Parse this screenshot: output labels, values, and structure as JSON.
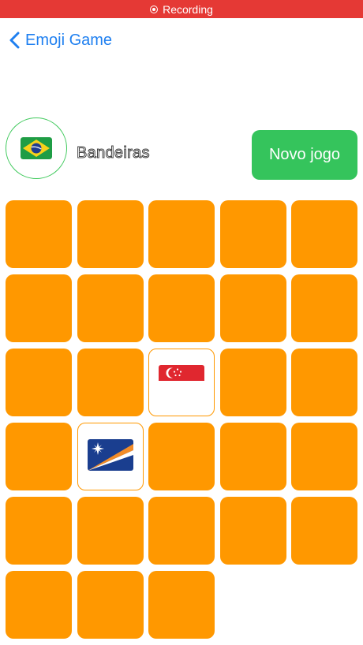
{
  "status_bar": {
    "label": "Recording"
  },
  "nav": {
    "back_label": "Emoji Game"
  },
  "header": {
    "category_icon": "brazil-flag",
    "category_label": "Bandeiras",
    "new_game_label": "Novo jogo"
  },
  "colors": {
    "card_back": "#ff9800",
    "new_game_button": "#35c45c",
    "recording_bar": "#e53935",
    "back_link": "#1e7ff0"
  },
  "cards": [
    {
      "state": "hidden"
    },
    {
      "state": "hidden"
    },
    {
      "state": "hidden"
    },
    {
      "state": "hidden"
    },
    {
      "state": "hidden"
    },
    {
      "state": "hidden"
    },
    {
      "state": "hidden"
    },
    {
      "state": "hidden"
    },
    {
      "state": "hidden"
    },
    {
      "state": "hidden"
    },
    {
      "state": "hidden"
    },
    {
      "state": "hidden"
    },
    {
      "state": "revealed",
      "flag": "singapore-flag"
    },
    {
      "state": "hidden"
    },
    {
      "state": "hidden"
    },
    {
      "state": "hidden"
    },
    {
      "state": "revealed",
      "flag": "marshall-islands-flag"
    },
    {
      "state": "hidden"
    },
    {
      "state": "hidden"
    },
    {
      "state": "hidden"
    },
    {
      "state": "hidden"
    },
    {
      "state": "hidden"
    },
    {
      "state": "hidden"
    },
    {
      "state": "hidden"
    },
    {
      "state": "hidden"
    },
    {
      "state": "hidden"
    },
    {
      "state": "hidden"
    },
    {
      "state": "hidden"
    }
  ]
}
